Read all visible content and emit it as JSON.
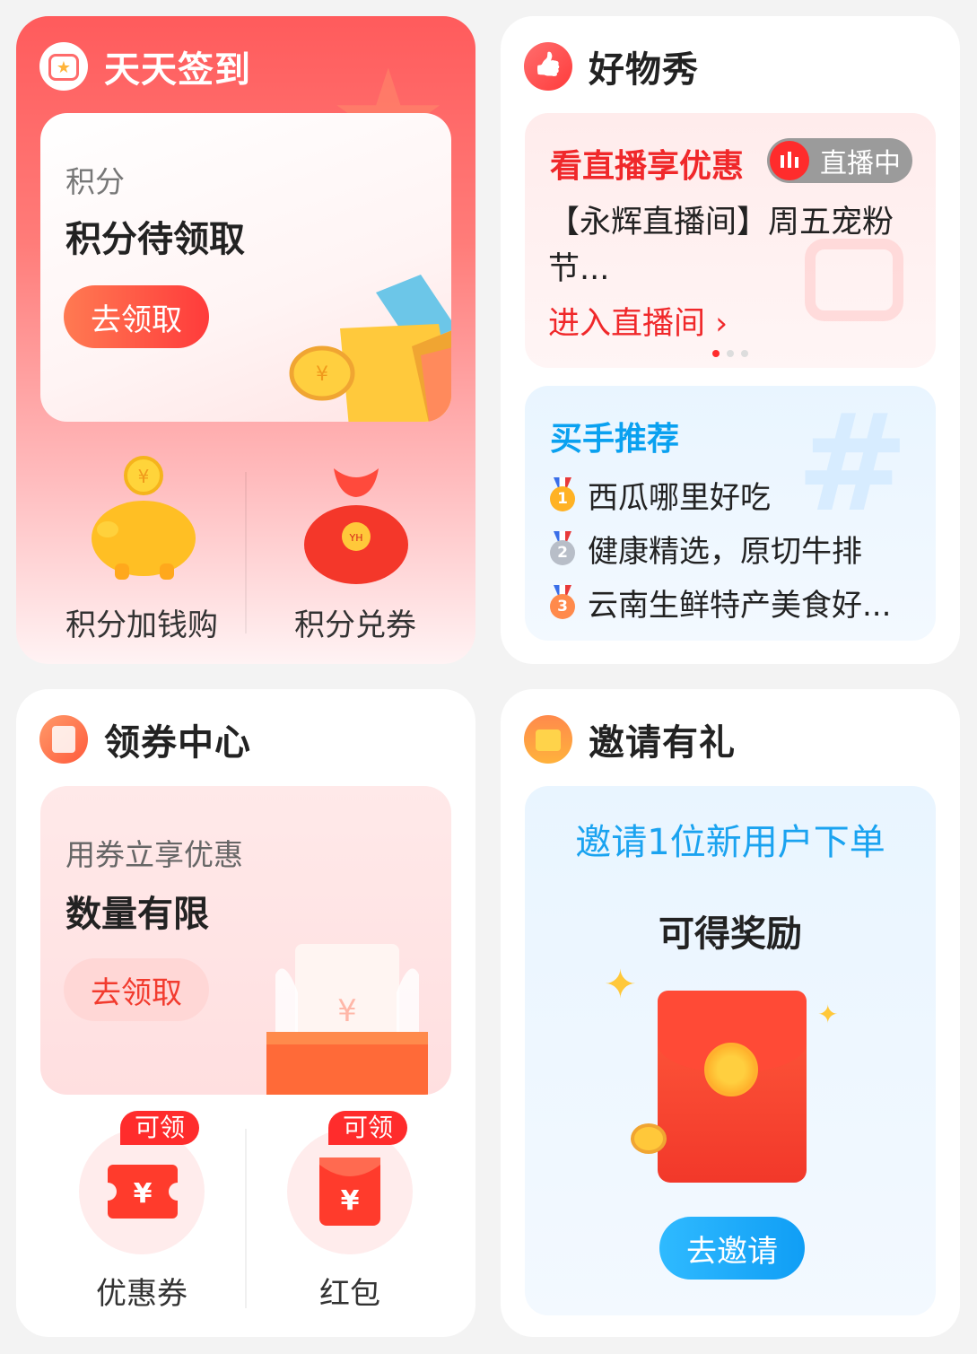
{
  "checkin": {
    "title": "天天签到",
    "points_label": "积分",
    "points_status": "积分待领取",
    "claim_button": "去领取",
    "items": [
      {
        "label": "积分加钱购"
      },
      {
        "label": "积分兑券"
      }
    ]
  },
  "good_show": {
    "title": "好物秀",
    "live": {
      "title": "看直播享优惠",
      "badge": "直播中",
      "desc": "【永辉直播间】周五宠粉节...",
      "link": "进入直播间 ›"
    },
    "recommend": {
      "title": "买手推荐",
      "items": [
        {
          "rank": "1",
          "text": "西瓜哪里好吃"
        },
        {
          "rank": "2",
          "text": "健康精选，原切牛排"
        },
        {
          "rank": "3",
          "text": "云南生鲜特产美食好..."
        }
      ]
    }
  },
  "coupon_center": {
    "title": "领券中心",
    "subtitle": "用券立享优惠",
    "status": "数量有限",
    "claim_button": "去领取",
    "items": [
      {
        "label": "优惠券",
        "tag": "可领"
      },
      {
        "label": "红包",
        "tag": "可领"
      }
    ]
  },
  "invite": {
    "title": "邀请有礼",
    "headline": "邀请1位新用户下单",
    "sub": "可得奖励",
    "button": "去邀请"
  },
  "colors": {
    "accent_red": "#ff2c2c",
    "accent_blue": "#1aa3f0"
  }
}
